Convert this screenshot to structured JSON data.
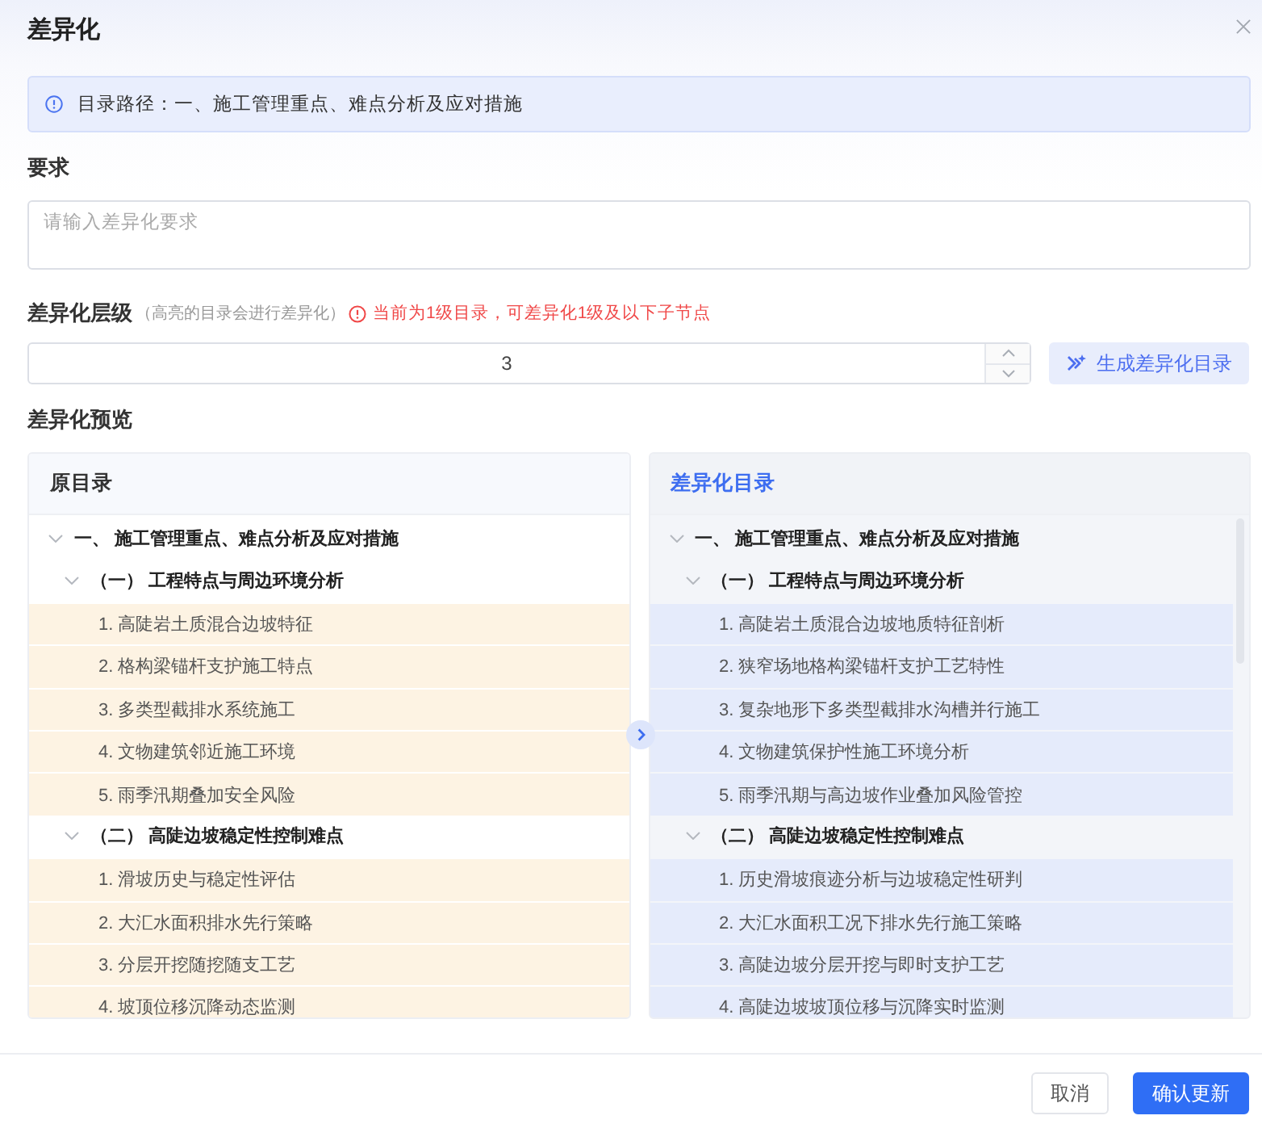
{
  "dialog": {
    "title": "差异化"
  },
  "alert": {
    "text": "目录路径：一、施工管理重点、难点分析及应对措施"
  },
  "requirement": {
    "label": "要求",
    "placeholder": "请输入差异化要求"
  },
  "level": {
    "label": "差异化层级",
    "hint": "（高亮的目录会进行差异化）",
    "warning": "当前为1级目录，可差异化1级及以下子节点",
    "value": "3"
  },
  "generate_button": "生成差异化目录",
  "preview": {
    "label": "差异化预览",
    "panels": [
      {
        "title": "原目录",
        "kind": "original",
        "tree": [
          {
            "label": "一、 施工管理重点、难点分析及应对措施",
            "expanded": true,
            "highlighted": false,
            "children": [
              {
                "label": "（一） 工程特点与周边环境分析",
                "expanded": true,
                "highlighted": false,
                "children": [
                  {
                    "label": "1. 高陡岩土质混合边坡特征",
                    "highlighted": true
                  },
                  {
                    "label": "2. 格构梁锚杆支护施工特点",
                    "highlighted": true
                  },
                  {
                    "label": "3. 多类型截排水系统施工",
                    "highlighted": true
                  },
                  {
                    "label": "4. 文物建筑邻近施工环境",
                    "highlighted": true
                  },
                  {
                    "label": "5. 雨季汛期叠加安全风险",
                    "highlighted": true
                  }
                ]
              },
              {
                "label": "（二） 高陡边坡稳定性控制难点",
                "expanded": true,
                "highlighted": false,
                "children": [
                  {
                    "label": "1. 滑坡历史与稳定性评估",
                    "highlighted": true
                  },
                  {
                    "label": "2. 大汇水面积排水先行策略",
                    "highlighted": true
                  },
                  {
                    "label": "3. 分层开挖随挖随支工艺",
                    "highlighted": true
                  },
                  {
                    "label": "4. 坡顶位移沉降动态监测",
                    "highlighted": true
                  }
                ]
              }
            ]
          }
        ]
      },
      {
        "title": "差异化目录",
        "kind": "result",
        "tree": [
          {
            "label": "一、 施工管理重点、难点分析及应对措施",
            "expanded": true,
            "highlighted": false,
            "children": [
              {
                "label": "（一） 工程特点与周边环境分析",
                "expanded": true,
                "highlighted": false,
                "children": [
                  {
                    "label": "1. 高陡岩土质混合边坡地质特征剖析",
                    "highlighted": true
                  },
                  {
                    "label": "2. 狭窄场地格构梁锚杆支护工艺特性",
                    "highlighted": true
                  },
                  {
                    "label": "3. 复杂地形下多类型截排水沟槽并行施工",
                    "highlighted": true
                  },
                  {
                    "label": "4. 文物建筑保护性施工环境分析",
                    "highlighted": true
                  },
                  {
                    "label": "5. 雨季汛期与高边坡作业叠加风险管控",
                    "highlighted": true
                  }
                ]
              },
              {
                "label": "（二） 高陡边坡稳定性控制难点",
                "expanded": true,
                "highlighted": false,
                "children": [
                  {
                    "label": "1. 历史滑坡痕迹分析与边坡稳定性研判",
                    "highlighted": true
                  },
                  {
                    "label": "2. 大汇水面积工况下排水先行施工策略",
                    "highlighted": true
                  },
                  {
                    "label": "3. 高陡边坡分层开挖与即时支护工艺",
                    "highlighted": true
                  },
                  {
                    "label": "4. 高陡边坡坡顶位移与沉降实时监测",
                    "highlighted": true
                  }
                ]
              }
            ]
          }
        ]
      }
    ]
  },
  "buttons": [
    {
      "label": "取消",
      "kind": "secondary"
    },
    {
      "label": "确认更新",
      "kind": "primary"
    }
  ]
}
